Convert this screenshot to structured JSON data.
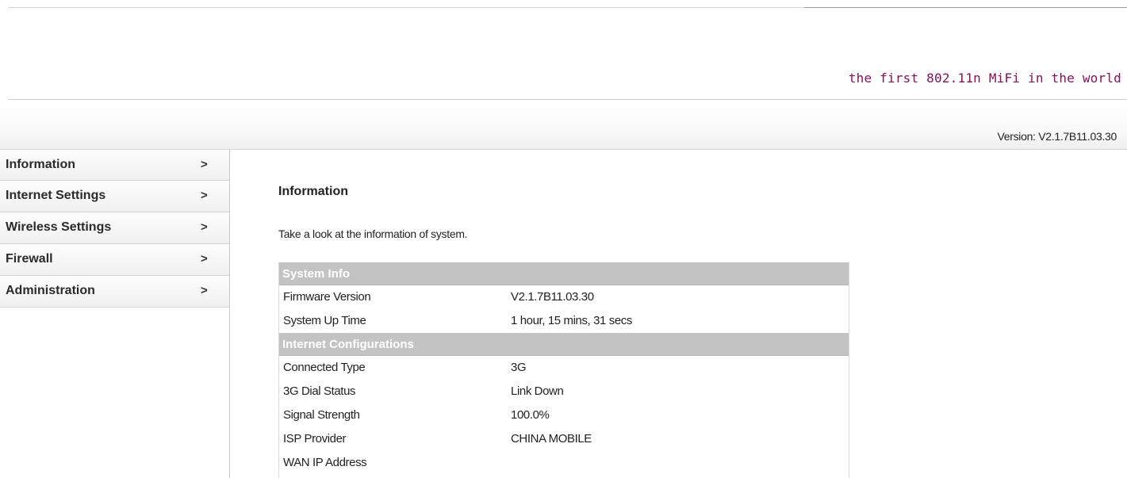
{
  "header": {
    "tagline": "the first 802.11n MiFi in the world",
    "version": "Version: V2.1.7B11.03.30"
  },
  "sidebar": {
    "items": [
      {
        "label": "Information",
        "arrow": ">"
      },
      {
        "label": "Internet Settings",
        "arrow": ">"
      },
      {
        "label": "Wireless Settings",
        "arrow": ">"
      },
      {
        "label": "Firewall",
        "arrow": ">"
      },
      {
        "label": "Administration",
        "arrow": ">"
      }
    ]
  },
  "main": {
    "title": "Information",
    "description": "Take a look at the information of system.",
    "sections": [
      {
        "title": "System Info",
        "rows": [
          {
            "label": "Firmware Version",
            "value": "V2.1.7B11.03.30"
          },
          {
            "label": "System Up Time",
            "value": "1 hour, 15 mins, 31 secs"
          }
        ]
      },
      {
        "title": "Internet Configurations",
        "rows": [
          {
            "label": "Connected Type",
            "value": "3G"
          },
          {
            "label": "3G Dial Status",
            "value": "Link Down"
          },
          {
            "label": "Signal Strength",
            "value": "100.0%"
          },
          {
            "label": "ISP Provider",
            "value": "CHINA MOBILE"
          },
          {
            "label": "WAN IP Address",
            "value": ""
          }
        ]
      }
    ]
  },
  "colors": {
    "tagline": "#8a0f5a",
    "section_header_bg": "#c3c3c3",
    "section_header_text": "#ffffff"
  }
}
